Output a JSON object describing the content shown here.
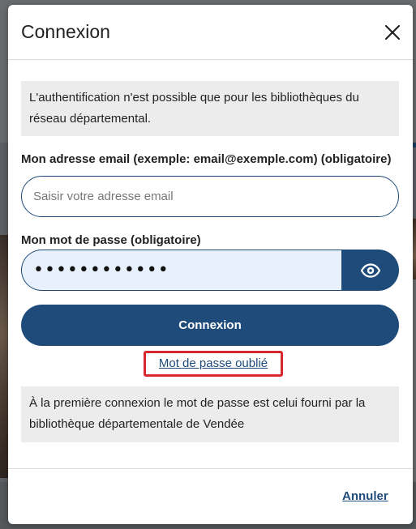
{
  "modal": {
    "title": "Connexion",
    "info_top": "L'authentification n'est possible que pour les bibliothèques du réseau départemental.",
    "email": {
      "label": "Mon adresse email (exemple: email@exemple.com) (obligatoire)",
      "placeholder": "Saisir votre adresse email",
      "value": ""
    },
    "password": {
      "label": "Mon mot de passe (obligatoire)",
      "masked_value": "••••••••••••"
    },
    "submit_label": "Connexion",
    "forgot_label": "Mot de passe oublié",
    "info_bottom": "À la première connexion le mot de passe est celui fourni par la bibliothèque départementale de Vendée",
    "cancel_label": "Annuler"
  },
  "colors": {
    "primary": "#1f4b7a",
    "highlight_box": "#d9272e",
    "info_bg": "#ececec",
    "autofill_bg": "#e8f0fe"
  },
  "icons": {
    "close": "close-icon",
    "show_password": "eye-icon"
  }
}
